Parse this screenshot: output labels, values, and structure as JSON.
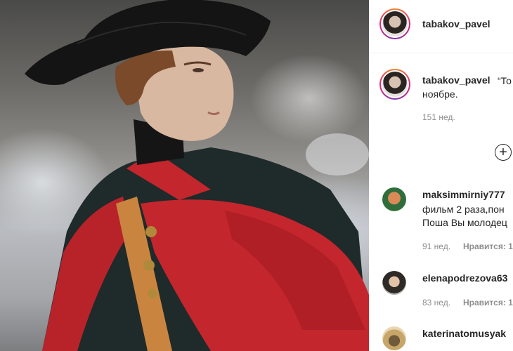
{
  "post": {
    "image_alt": "Man in black tricorn hat and dark coat with red-lined cape",
    "author": "tabakov_pavel"
  },
  "caption": {
    "username": "tabakov_pavel",
    "text_line1": "“То",
    "text_line2": "ноябре.",
    "time": "151 нед."
  },
  "add_comment_icon": "plus-circle-icon",
  "comments": [
    {
      "username": "maksimmirniy777",
      "line1": "фильм 2 раза,пон",
      "line2": "Поша Вы молодец",
      "time": "91 нед.",
      "likes": "Нравится: 1"
    },
    {
      "username": "elenapodrezova63",
      "time": "83 нед.",
      "likes": "Нравится: 1"
    },
    {
      "username": "katerinatomusyak"
    }
  ]
}
